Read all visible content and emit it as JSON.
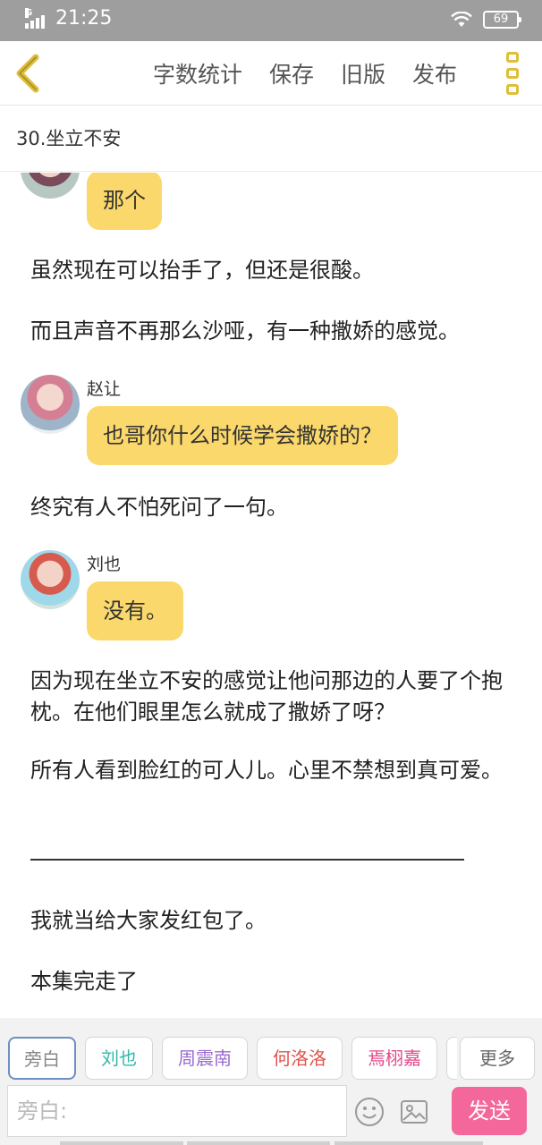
{
  "status": {
    "time": "21:25",
    "battery": "69",
    "network": "G"
  },
  "toolbar": {
    "actions": [
      "字数统计",
      "保存",
      "旧版",
      "发布"
    ]
  },
  "chapter_title": "30.坐立不安",
  "messages": {
    "b0": "那个",
    "p1": "虽然现在可以抬手了，但还是很酸。",
    "p2": "而且声音不再那么沙哑，有一种撒娇的感觉。",
    "s1_name": "赵让",
    "b1": "也哥你什么时候学会撒娇的？",
    "p3": "终究有人不怕死问了一句。",
    "s2_name": "刘也",
    "b2": "没有。",
    "p4": "因为现在坐立不安的感觉让他问那边的人要了个抱枕。在他们眼里怎么就成了撒娇了呀？",
    "p5": "所有人看到脸红的可人儿。心里不禁想到真可爱。",
    "p6": "我就当给大家发红包了。",
    "p7": "本集完走了"
  },
  "bottom": {
    "chips": [
      {
        "label": "旁白",
        "color": "#888888"
      },
      {
        "label": "刘也",
        "color": "#2fb8a8"
      },
      {
        "label": "周震南",
        "color": "#9a6bd1"
      },
      {
        "label": "何洛洛",
        "color": "#e0534a"
      },
      {
        "label": "焉栩嘉",
        "color": "#e0498a"
      },
      {
        "label": "",
        "color": "#888888"
      }
    ],
    "more": "更多",
    "input_placeholder": "旁白:",
    "send": "发送"
  },
  "icons": [
    "back-icon",
    "kebab-menu-icon",
    "emoji-icon",
    "image-icon",
    "wifi-icon",
    "battery-icon",
    "signal-icon"
  ]
}
